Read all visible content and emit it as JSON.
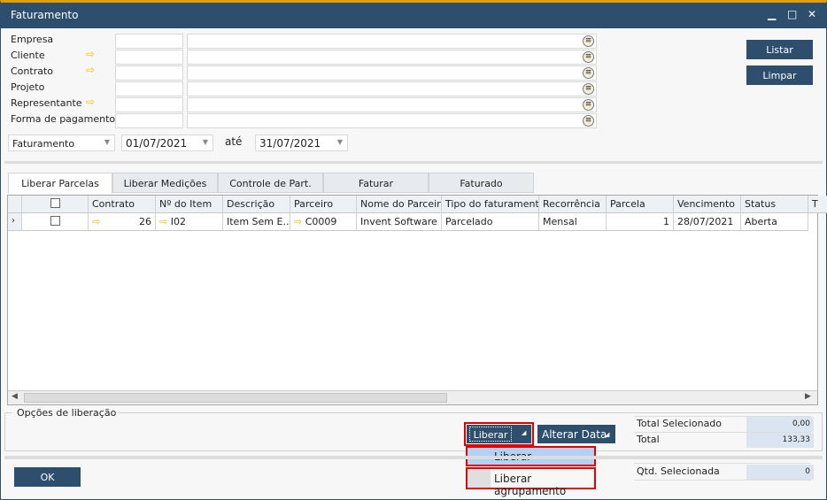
{
  "window": {
    "title": "Faturamento",
    "minimize": "▁",
    "maximize": "□",
    "close": "✕"
  },
  "filters": [
    {
      "label": "Empresa",
      "arrow": false
    },
    {
      "label": "Cliente",
      "arrow": true
    },
    {
      "label": "Contrato",
      "arrow": true
    },
    {
      "label": "Projeto",
      "arrow": false
    },
    {
      "label": "Representante",
      "arrow": true
    },
    {
      "label": "Forma de pagamento",
      "arrow": false
    }
  ],
  "date_filter": {
    "type": "Faturamento",
    "from": "01/07/2021",
    "until_label": "até",
    "to": "31/07/2021"
  },
  "buttons": {
    "listar": "Listar",
    "limpar": "Limpar",
    "ok": "OK",
    "liberar": "Liberar",
    "alterar_data": "Alterar Data"
  },
  "tabs": [
    "Liberar Parcelas",
    "Liberar Medições",
    "Controle de Part.",
    "Faturar",
    "Faturado"
  ],
  "active_tab": "Liberar Parcelas",
  "grid": {
    "columns": [
      "Contrato",
      "Nº do Item",
      "Descrição",
      "Parceiro",
      "Nome do Parceiro",
      "Tipo do faturamento",
      "Recorrência",
      "Parcela",
      "Vencimento",
      "Status",
      "T"
    ],
    "rows": [
      {
        "contrato": "26",
        "item": "I02",
        "descricao": "Item Sem E...",
        "parceiro": "C0009",
        "nome": "Invent Software",
        "tipo": "Parcelado",
        "recorrencia": "Mensal",
        "parcela": "1",
        "vencimento": "28/07/2021",
        "status": "Aberta"
      }
    ]
  },
  "options_group": "Opções de liberação",
  "dropdown_menu": [
    "Liberar",
    "Liberar agrupamento"
  ],
  "totals": {
    "selecionado_label": "Total Selecionado",
    "selecionado": "0,00",
    "total_label": "Total",
    "total": "133,33",
    "qtd_label": "Qtd. Selecionada",
    "qtd": "0"
  },
  "colors": {
    "titlebar": "#2d4e6c",
    "accent": "#e0a000",
    "highlight": "#e00000",
    "menu_hover": "#b3d1f5"
  }
}
